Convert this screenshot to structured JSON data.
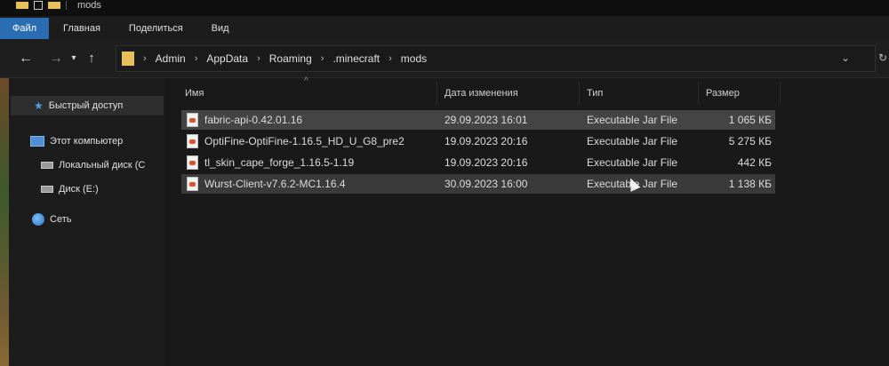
{
  "window": {
    "title": "mods"
  },
  "ribbon": {
    "tabs": [
      "Файл",
      "Главная",
      "Поделиться",
      "Вид"
    ]
  },
  "address": {
    "crumbs": [
      "Admin",
      "AppData",
      "Roaming",
      ".minecraft",
      "mods"
    ]
  },
  "sidebar": {
    "items": [
      {
        "label": "Быстрый доступ",
        "icon": "star-icon"
      },
      {
        "label": "Этот компьютер",
        "icon": "computer-icon"
      },
      {
        "label": "Локальный диск (C",
        "icon": "drive-icon"
      },
      {
        "label": "Диск (E:)",
        "icon": "drive-icon"
      },
      {
        "label": "Сеть",
        "icon": "network-icon"
      }
    ]
  },
  "columns": {
    "name": "Имя",
    "date": "Дата изменения",
    "type": "Тип",
    "size": "Размер"
  },
  "files": [
    {
      "name": "fabric-api-0.42.01.16",
      "date": "29.09.2023 16:01",
      "type": "Executable Jar File",
      "size": "1 065 КБ"
    },
    {
      "name": "OptiFine-OptiFine-1.16.5_HD_U_G8_pre2",
      "date": "19.09.2023 20:16",
      "type": "Executable Jar File",
      "size": "5 275 КБ"
    },
    {
      "name": "tl_skin_cape_forge_1.16.5-1.19",
      "date": "19.09.2023 20:16",
      "type": "Executable Jar File",
      "size": "442 КБ"
    },
    {
      "name": "Wurst-Client-v7.6.2-MC1.16.4",
      "date": "30.09.2023 16:00",
      "type": "Executable Jar File",
      "size": "1 138 КБ"
    }
  ],
  "colors": {
    "accent": "#2a6db3",
    "folder": "#e8c05a",
    "selection": "#444444"
  }
}
